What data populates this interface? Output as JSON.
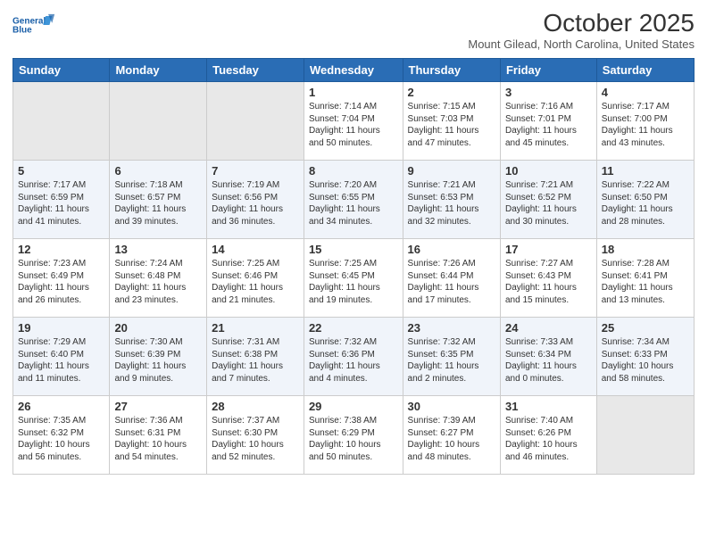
{
  "header": {
    "logo_line1": "General",
    "logo_line2": "Blue",
    "month_title": "October 2025",
    "location": "Mount Gilead, North Carolina, United States"
  },
  "days_of_week": [
    "Sunday",
    "Monday",
    "Tuesday",
    "Wednesday",
    "Thursday",
    "Friday",
    "Saturday"
  ],
  "weeks": [
    [
      {
        "day": "",
        "info": ""
      },
      {
        "day": "",
        "info": ""
      },
      {
        "day": "",
        "info": ""
      },
      {
        "day": "1",
        "info": "Sunrise: 7:14 AM\nSunset: 7:04 PM\nDaylight: 11 hours\nand 50 minutes."
      },
      {
        "day": "2",
        "info": "Sunrise: 7:15 AM\nSunset: 7:03 PM\nDaylight: 11 hours\nand 47 minutes."
      },
      {
        "day": "3",
        "info": "Sunrise: 7:16 AM\nSunset: 7:01 PM\nDaylight: 11 hours\nand 45 minutes."
      },
      {
        "day": "4",
        "info": "Sunrise: 7:17 AM\nSunset: 7:00 PM\nDaylight: 11 hours\nand 43 minutes."
      }
    ],
    [
      {
        "day": "5",
        "info": "Sunrise: 7:17 AM\nSunset: 6:59 PM\nDaylight: 11 hours\nand 41 minutes."
      },
      {
        "day": "6",
        "info": "Sunrise: 7:18 AM\nSunset: 6:57 PM\nDaylight: 11 hours\nand 39 minutes."
      },
      {
        "day": "7",
        "info": "Sunrise: 7:19 AM\nSunset: 6:56 PM\nDaylight: 11 hours\nand 36 minutes."
      },
      {
        "day": "8",
        "info": "Sunrise: 7:20 AM\nSunset: 6:55 PM\nDaylight: 11 hours\nand 34 minutes."
      },
      {
        "day": "9",
        "info": "Sunrise: 7:21 AM\nSunset: 6:53 PM\nDaylight: 11 hours\nand 32 minutes."
      },
      {
        "day": "10",
        "info": "Sunrise: 7:21 AM\nSunset: 6:52 PM\nDaylight: 11 hours\nand 30 minutes."
      },
      {
        "day": "11",
        "info": "Sunrise: 7:22 AM\nSunset: 6:50 PM\nDaylight: 11 hours\nand 28 minutes."
      }
    ],
    [
      {
        "day": "12",
        "info": "Sunrise: 7:23 AM\nSunset: 6:49 PM\nDaylight: 11 hours\nand 26 minutes."
      },
      {
        "day": "13",
        "info": "Sunrise: 7:24 AM\nSunset: 6:48 PM\nDaylight: 11 hours\nand 23 minutes."
      },
      {
        "day": "14",
        "info": "Sunrise: 7:25 AM\nSunset: 6:46 PM\nDaylight: 11 hours\nand 21 minutes."
      },
      {
        "day": "15",
        "info": "Sunrise: 7:25 AM\nSunset: 6:45 PM\nDaylight: 11 hours\nand 19 minutes."
      },
      {
        "day": "16",
        "info": "Sunrise: 7:26 AM\nSunset: 6:44 PM\nDaylight: 11 hours\nand 17 minutes."
      },
      {
        "day": "17",
        "info": "Sunrise: 7:27 AM\nSunset: 6:43 PM\nDaylight: 11 hours\nand 15 minutes."
      },
      {
        "day": "18",
        "info": "Sunrise: 7:28 AM\nSunset: 6:41 PM\nDaylight: 11 hours\nand 13 minutes."
      }
    ],
    [
      {
        "day": "19",
        "info": "Sunrise: 7:29 AM\nSunset: 6:40 PM\nDaylight: 11 hours\nand 11 minutes."
      },
      {
        "day": "20",
        "info": "Sunrise: 7:30 AM\nSunset: 6:39 PM\nDaylight: 11 hours\nand 9 minutes."
      },
      {
        "day": "21",
        "info": "Sunrise: 7:31 AM\nSunset: 6:38 PM\nDaylight: 11 hours\nand 7 minutes."
      },
      {
        "day": "22",
        "info": "Sunrise: 7:32 AM\nSunset: 6:36 PM\nDaylight: 11 hours\nand 4 minutes."
      },
      {
        "day": "23",
        "info": "Sunrise: 7:32 AM\nSunset: 6:35 PM\nDaylight: 11 hours\nand 2 minutes."
      },
      {
        "day": "24",
        "info": "Sunrise: 7:33 AM\nSunset: 6:34 PM\nDaylight: 11 hours\nand 0 minutes."
      },
      {
        "day": "25",
        "info": "Sunrise: 7:34 AM\nSunset: 6:33 PM\nDaylight: 10 hours\nand 58 minutes."
      }
    ],
    [
      {
        "day": "26",
        "info": "Sunrise: 7:35 AM\nSunset: 6:32 PM\nDaylight: 10 hours\nand 56 minutes."
      },
      {
        "day": "27",
        "info": "Sunrise: 7:36 AM\nSunset: 6:31 PM\nDaylight: 10 hours\nand 54 minutes."
      },
      {
        "day": "28",
        "info": "Sunrise: 7:37 AM\nSunset: 6:30 PM\nDaylight: 10 hours\nand 52 minutes."
      },
      {
        "day": "29",
        "info": "Sunrise: 7:38 AM\nSunset: 6:29 PM\nDaylight: 10 hours\nand 50 minutes."
      },
      {
        "day": "30",
        "info": "Sunrise: 7:39 AM\nSunset: 6:27 PM\nDaylight: 10 hours\nand 48 minutes."
      },
      {
        "day": "31",
        "info": "Sunrise: 7:40 AM\nSunset: 6:26 PM\nDaylight: 10 hours\nand 46 minutes."
      },
      {
        "day": "",
        "info": ""
      }
    ]
  ]
}
